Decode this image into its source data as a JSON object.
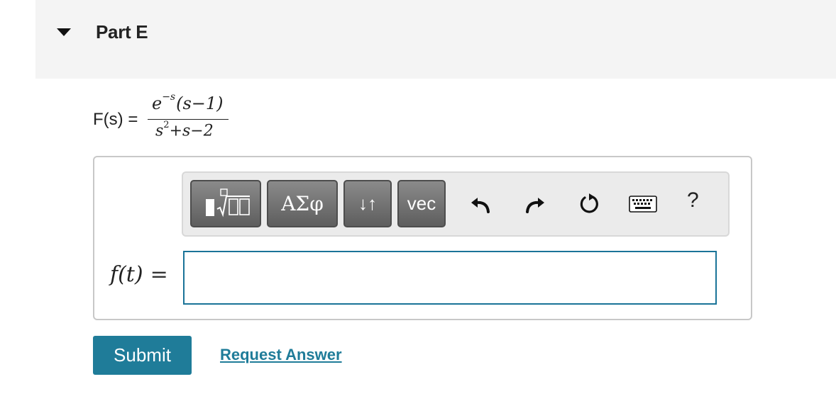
{
  "part": {
    "title": "Part E"
  },
  "problem": {
    "lhs": "F(s) =",
    "numerator_base": "e",
    "numerator_exponent": "−s",
    "numerator_rest": "(s−1)",
    "denominator_base": "s",
    "denominator_exponent": "2",
    "denominator_rest": "+s−2"
  },
  "toolbar": {
    "templates_label": "Templates",
    "greek_label": "ΑΣφ",
    "arrows_label": "↓↑",
    "vec_label": "vec",
    "undo_icon": "undo-icon",
    "redo_icon": "redo-icon",
    "reset_icon": "reset-icon",
    "keyboard_icon": "keyboard-icon",
    "help_label": "?"
  },
  "answer": {
    "lhs": "f(t)",
    "eq": "=",
    "value": ""
  },
  "actions": {
    "submit_label": "Submit",
    "request_label": "Request Answer"
  },
  "colors": {
    "accent": "#1f7c99",
    "input_border": "#1a7398",
    "header_bg": "#f4f4f4",
    "toolbar_button": "#6b6b6b"
  }
}
